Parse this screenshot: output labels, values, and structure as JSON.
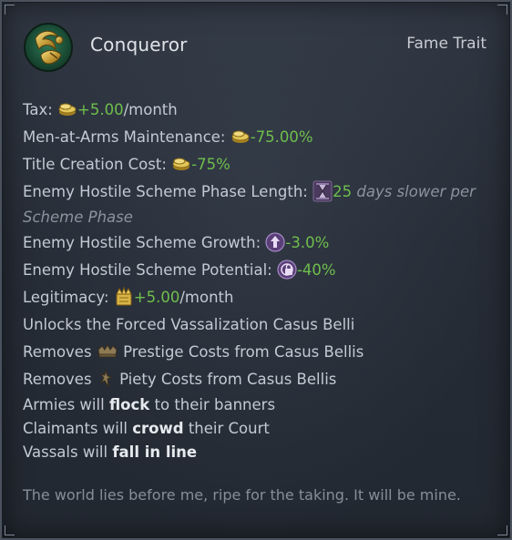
{
  "trait": {
    "name": "Conqueror",
    "category": "Fame Trait",
    "icon": "conqueror-trait-icon"
  },
  "effects": {
    "tax": {
      "label": "Tax:",
      "icon": "gold-icon",
      "value": "+5.00",
      "suffix": "/month"
    },
    "maa_maintenance": {
      "label": "Men-at-Arms Maintenance:",
      "icon": "gold-icon",
      "value": "-75.00%"
    },
    "title_creation": {
      "label": "Title Creation Cost:",
      "icon": "gold-icon",
      "value": "-75%"
    },
    "scheme_phase": {
      "label": "Enemy Hostile Scheme Phase Length:",
      "icon": "hourglass-icon",
      "value": "25",
      "note_line1": "days slower per",
      "note_line2": "Scheme Phase"
    },
    "scheme_growth": {
      "label": "Enemy Hostile Scheme Growth:",
      "icon": "scheme-growth-icon",
      "value": "-3.0%"
    },
    "scheme_potential": {
      "label": "Enemy Hostile Scheme Potential:",
      "icon": "scheme-potential-icon",
      "value": "-40%"
    },
    "legitimacy": {
      "label": "Legitimacy:",
      "icon": "legitimacy-crown-icon",
      "value": "+5.00",
      "suffix": "/month"
    },
    "unlocks": "Unlocks the Forced Vassalization Casus Belli",
    "removes_prestige": {
      "prefix": "Removes",
      "icon": "prestige-crown-icon",
      "text": "Prestige Costs from Casus Bellis"
    },
    "removes_piety": {
      "prefix": "Removes",
      "icon": "piety-icon",
      "text": "Piety Costs from Casus Bellis"
    },
    "armies": {
      "before": "Armies will",
      "bold": "flock",
      "after": "to their banners"
    },
    "claimants": {
      "before": "Claimants will",
      "bold": "crowd",
      "after": "their Court"
    },
    "vassals": {
      "before": "Vassals will",
      "bold": "fall in line"
    }
  },
  "flavor": "The world lies before me, ripe for the taking. It will be mine.",
  "colors": {
    "positive": "#6fbf4c",
    "text": "#c3cad4",
    "muted": "#8b939e",
    "panel": "#2a303a"
  }
}
